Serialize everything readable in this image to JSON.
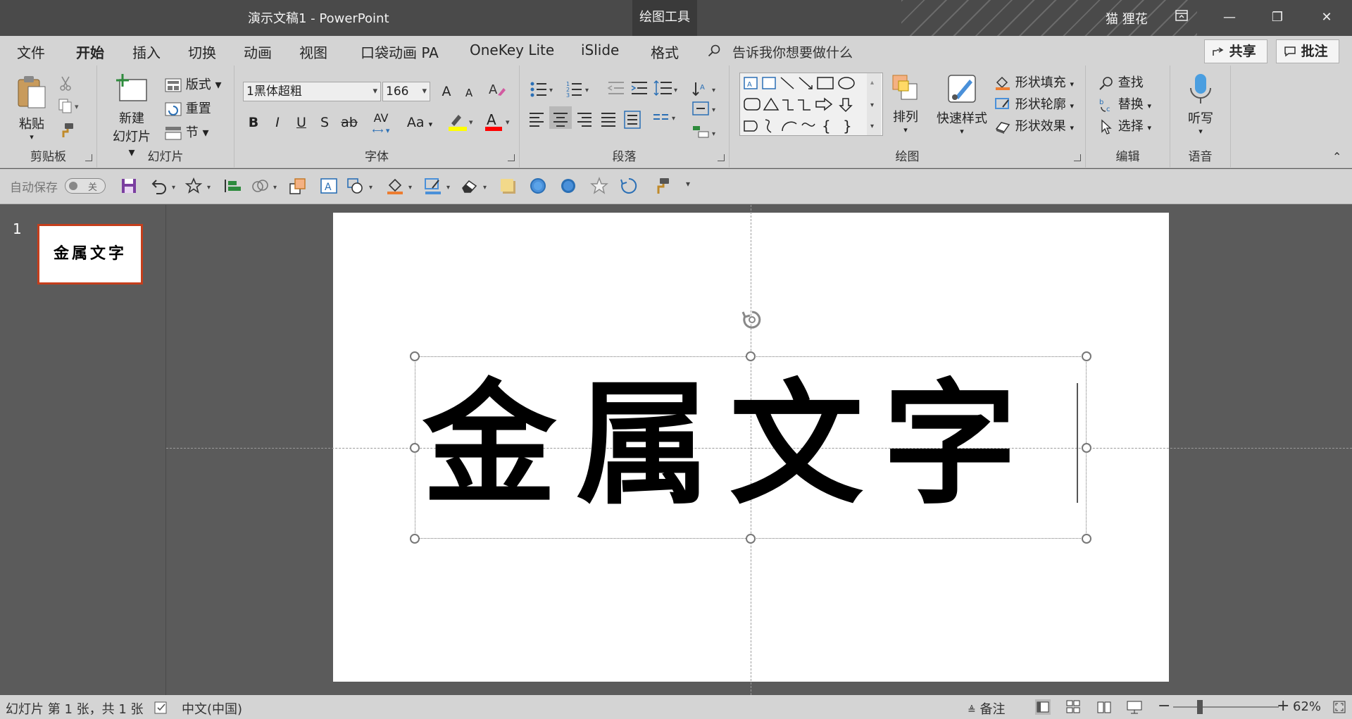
{
  "titlebar": {
    "document_title": "演示文稿1  -  PowerPoint",
    "context_tab": "绘图工具",
    "user_name": "猫 狸花",
    "ribbon_display_icon": "ribbon-display-icon",
    "minimize": "—",
    "restore": "❐",
    "close": "✕"
  },
  "menu": {
    "tabs": [
      "文件",
      "开始",
      "插入",
      "切换",
      "动画",
      "视图",
      "口袋动画 PA",
      "OneKey Lite",
      "iSlide",
      "格式"
    ],
    "active_tab": "开始",
    "tell_me": "告诉我你想要做什么",
    "share": "共享",
    "comment": "批注"
  },
  "ribbon": {
    "clipboard": {
      "label": "剪贴板",
      "paste": "粘贴"
    },
    "slides": {
      "label": "幻灯片",
      "new_slide_line1": "新建",
      "new_slide_line2": "幻灯片",
      "layout": "版式",
      "reset": "重置",
      "section": "节"
    },
    "font": {
      "label": "字体",
      "font_name": "1黑体超粗",
      "font_size": "166",
      "bold": "B",
      "italic": "I",
      "underline": "U",
      "shadow": "S",
      "strike": "ab",
      "spacing": "AV",
      "case": "Aa",
      "grow": "A",
      "shrink": "A"
    },
    "paragraph": {
      "label": "段落"
    },
    "drawing": {
      "label": "绘图",
      "arrange": "排列",
      "quick_styles": "快速样式",
      "shape_fill": "形状填充",
      "shape_outline": "形状轮廓",
      "shape_effects": "形状效果"
    },
    "editing": {
      "label": "编辑",
      "find": "查找",
      "replace": "替换",
      "select": "选择"
    },
    "voice": {
      "label": "语音",
      "dictate": "听写"
    }
  },
  "qat": {
    "autosave": "自动保存",
    "toggle_state": "关"
  },
  "slides_pane": {
    "number": "1",
    "thumb_text": "金属文字"
  },
  "slide": {
    "text": "金属文字"
  },
  "status": {
    "slide_info": "幻灯片 第 1 张，共 1 张",
    "language": "中文(中国)",
    "notes": "备注",
    "zoom_minus": "−",
    "zoom_plus": "+",
    "zoom": "62%"
  },
  "colors": {
    "accent": "#c43e1c",
    "titlebar": "#4a4a4a",
    "ribbon": "#d4d4d4",
    "highlight": "#ffff00",
    "font_color": "#ff0000"
  }
}
